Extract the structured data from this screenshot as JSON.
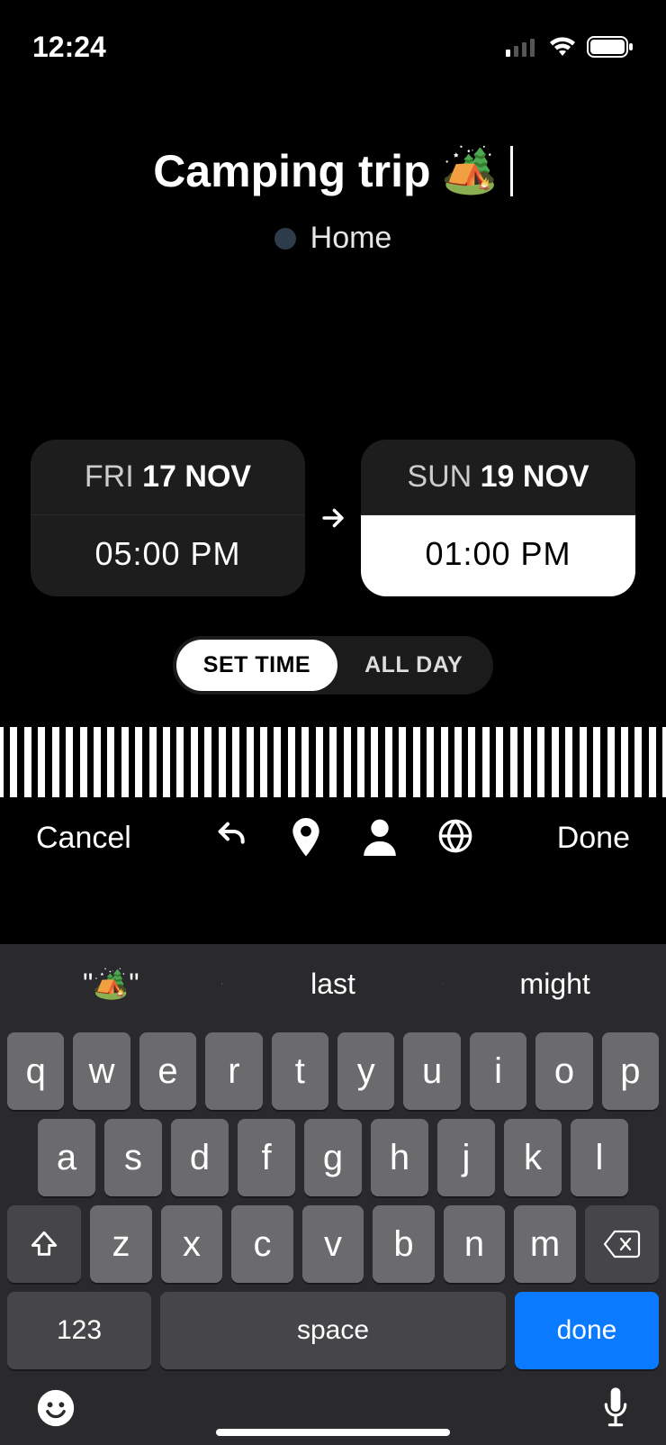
{
  "status_bar": {
    "time": "12:24"
  },
  "event": {
    "title": "Camping trip",
    "emoji": "🏕️"
  },
  "calendar": {
    "name": "Home"
  },
  "start": {
    "dow": "FRI",
    "date": "17 NOV",
    "time": "05:00 PM"
  },
  "end": {
    "dow": "SUN",
    "date": "19 NOV",
    "time": "01:00 PM"
  },
  "time_mode": {
    "set_time": "SET TIME",
    "all_day": "ALL DAY",
    "active": "set_time"
  },
  "actions": {
    "cancel": "Cancel",
    "done": "Done"
  },
  "keyboard": {
    "suggestions": [
      "\"🏕️\"",
      "last",
      "might"
    ],
    "row1": [
      "q",
      "w",
      "e",
      "r",
      "t",
      "y",
      "u",
      "i",
      "o",
      "p"
    ],
    "row2": [
      "a",
      "s",
      "d",
      "f",
      "g",
      "h",
      "j",
      "k",
      "l"
    ],
    "row3": [
      "z",
      "x",
      "c",
      "v",
      "b",
      "n",
      "m"
    ],
    "numbers_label": "123",
    "space_label": "space",
    "done_label": "done"
  }
}
